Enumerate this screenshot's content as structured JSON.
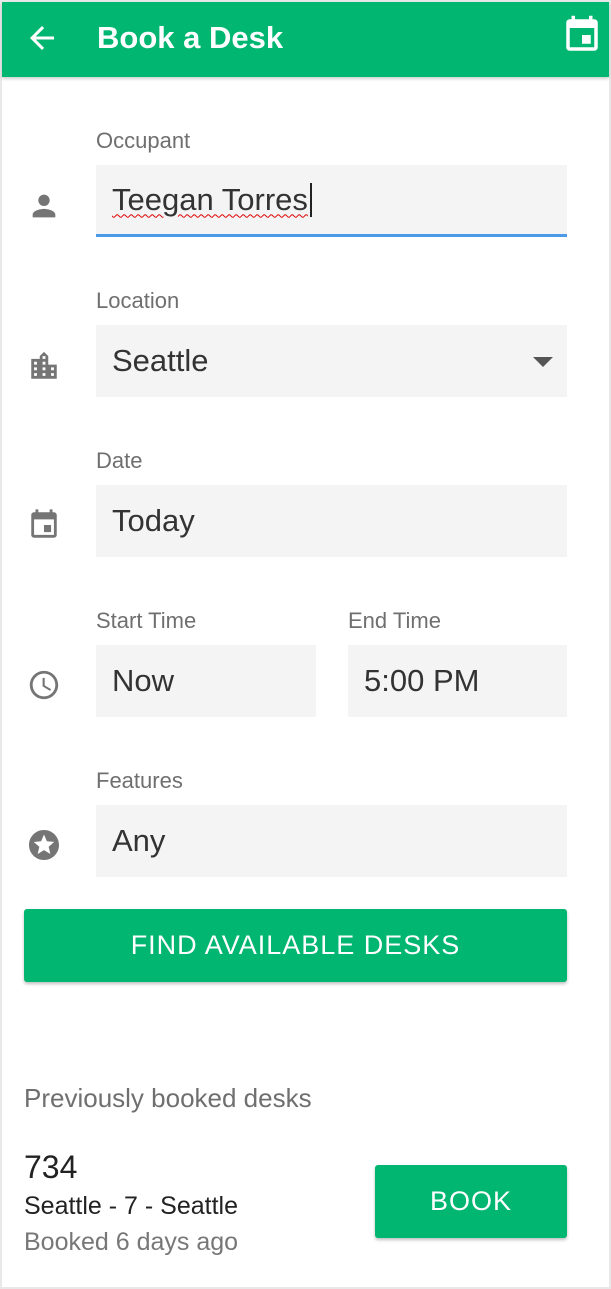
{
  "appbar": {
    "title": "Book a Desk",
    "back_icon": "arrow-left-icon",
    "calendar_icon": "calendar-icon",
    "color": "#00b671"
  },
  "form": {
    "occupant": {
      "label": "Occupant",
      "value": "Teegan Torres",
      "icon": "person-icon"
    },
    "location": {
      "label": "Location",
      "value": "Seattle",
      "icon": "building-icon"
    },
    "date": {
      "label": "Date",
      "value": "Today",
      "icon": "calendar-icon"
    },
    "start_time": {
      "label": "Start Time",
      "value": "Now",
      "icon": "clock-icon"
    },
    "end_time": {
      "label": "End Time",
      "value": "5:00 PM"
    },
    "features": {
      "label": "Features",
      "value": "Any",
      "icon": "star-icon"
    },
    "find_button": "FIND AVAILABLE DESKS"
  },
  "previous": {
    "title": "Previously booked desks",
    "items": [
      {
        "desk": "734",
        "location": "Seattle - 7 - Seattle",
        "booked": "Booked 6 days ago",
        "button": "BOOK"
      }
    ]
  },
  "colors": {
    "accent": "#00b671",
    "focus_underline": "#4a9ae8",
    "field_bg": "#f4f4f4"
  }
}
